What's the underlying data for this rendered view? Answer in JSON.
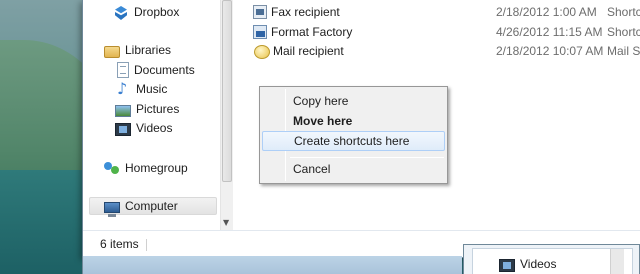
{
  "nav_pane": {
    "items": [
      {
        "label": "Dropbox",
        "icon": "dropbox-icon"
      },
      {
        "label": "Libraries",
        "icon": "libraries-icon"
      },
      {
        "label": "Documents",
        "icon": "documents-icon"
      },
      {
        "label": "Music",
        "icon": "music-icon"
      },
      {
        "label": "Pictures",
        "icon": "pictures-icon"
      },
      {
        "label": "Videos",
        "icon": "videos-icon"
      },
      {
        "label": "Homegroup",
        "icon": "homegroup-icon"
      },
      {
        "label": "Computer",
        "icon": "computer-icon",
        "selected": true
      }
    ]
  },
  "files": [
    {
      "name": "Fax recipient",
      "date": "2/18/2012 1:00 AM",
      "type": "Shortcut"
    },
    {
      "name": "Format Factory",
      "date": "4/26/2012 11:15 AM",
      "type": "Shortcut"
    },
    {
      "name": "Mail recipient",
      "date": "2/18/2012 10:07 AM",
      "type": "Mail Se"
    }
  ],
  "status_bar": {
    "item_count": "6 items"
  },
  "context_menu": {
    "items": [
      {
        "label": "Copy here"
      },
      {
        "label": "Move here",
        "default": true
      },
      {
        "label": "Create shortcuts here",
        "highlighted": true
      },
      {
        "label": "Cancel"
      }
    ]
  },
  "background_window": {
    "nav_item": "Videos"
  }
}
